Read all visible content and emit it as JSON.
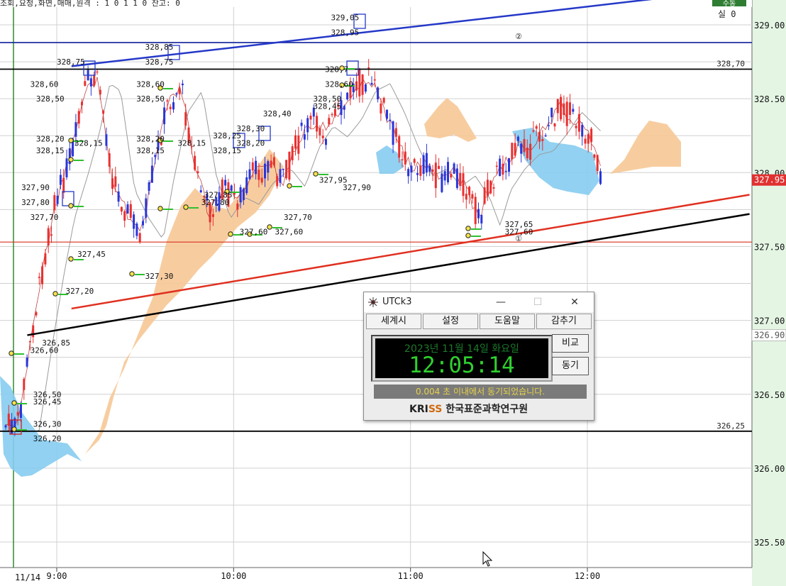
{
  "header": {
    "top_text": "조회,요청,화면,매매,원격 : 1 0 1 1 0 잔고: 0",
    "status_badge": "수동",
    "real_label": "실 0"
  },
  "price_axis": {
    "ticks": [
      "329.00",
      "328.50",
      "328.00",
      "327.50",
      "327.00",
      "326.50",
      "326.00",
      "325.50"
    ],
    "current_price": "327.95",
    "partial_tag": "326.90"
  },
  "time_axis": {
    "date_label": "11/14",
    "ticks": [
      "9:00",
      "10:00",
      "11:00",
      "12:00"
    ]
  },
  "chart_data": {
    "type": "candlestick",
    "y_range": [
      325.3,
      329.15
    ],
    "x_range": [
      "8:45",
      "12:55"
    ],
    "horizontal_lines": [
      {
        "value": 328.7,
        "label": "328,70",
        "color": "#000000"
      },
      {
        "value": 328.88,
        "label": "②",
        "color": "#1e2fa0"
      },
      {
        "value": 327.53,
        "label": "",
        "color": "#d83020"
      },
      {
        "value": 326.25,
        "label": "326,25",
        "color": "#000000"
      }
    ],
    "trend_lines": [
      {
        "label": "",
        "color": "#2438c8",
        "from": [
          "9:05",
          328.72
        ],
        "to": [
          "12:55",
          329.25
        ]
      },
      {
        "label": "①",
        "color": "#e03020",
        "from": [
          "9:05",
          327.08
        ],
        "to": [
          "12:55",
          327.85
        ]
      },
      {
        "label": "",
        "color": "#000000",
        "from": [
          "8:50",
          326.9
        ],
        "to": [
          "12:55",
          327.72
        ]
      }
    ],
    "price_labels": [
      {
        "time": "8:52",
        "price": 326.5,
        "text": "326,50"
      },
      {
        "time": "8:52",
        "price": 326.45,
        "text": "326,45"
      },
      {
        "time": "8:52",
        "price": 326.3,
        "text": "326,30"
      },
      {
        "time": "8:52",
        "price": 326.2,
        "text": "326,20"
      },
      {
        "time": "8:55",
        "price": 326.85,
        "text": "326,85"
      },
      {
        "time": "8:51",
        "price": 326.8,
        "text": "326,60"
      },
      {
        "time": "9:00",
        "price": 328.75,
        "text": "328,75"
      },
      {
        "time": "8:51",
        "price": 328.6,
        "text": "328,60"
      },
      {
        "time": "8:53",
        "price": 328.5,
        "text": "328,50"
      },
      {
        "time": "8:53",
        "price": 328.23,
        "text": "328,20"
      },
      {
        "time": "8:53",
        "price": 328.15,
        "text": "328,15"
      },
      {
        "time": "9:06",
        "price": 328.2,
        "text": "328,15"
      },
      {
        "time": "8:48",
        "price": 327.9,
        "text": "327,90"
      },
      {
        "time": "8:48",
        "price": 327.8,
        "text": "327,80"
      },
      {
        "time": "8:51",
        "price": 327.7,
        "text": "327,70"
      },
      {
        "time": "9:07",
        "price": 327.45,
        "text": "327,45"
      },
      {
        "time": "9:03",
        "price": 327.2,
        "text": "327,20"
      },
      {
        "time": "9:30",
        "price": 328.85,
        "text": "328,85"
      },
      {
        "time": "9:30",
        "price": 328.75,
        "text": "328,75"
      },
      {
        "time": "9:27",
        "price": 328.6,
        "text": "328,60"
      },
      {
        "time": "9:27",
        "price": 328.5,
        "text": "328,50"
      },
      {
        "time": "9:27",
        "price": 328.23,
        "text": "328,20"
      },
      {
        "time": "9:27",
        "price": 328.15,
        "text": "328,15"
      },
      {
        "time": "9:41",
        "price": 328.2,
        "text": "328,15"
      },
      {
        "time": "9:30",
        "price": 327.3,
        "text": "327,30"
      },
      {
        "time": "9:53",
        "price": 328.25,
        "text": "328,25"
      },
      {
        "time": "9:53",
        "price": 328.15,
        "text": "328,15"
      },
      {
        "time": "10:01",
        "price": 328.3,
        "text": "328,30"
      },
      {
        "time": "10:01",
        "price": 328.2,
        "text": "328,20"
      },
      {
        "time": "9:50",
        "price": 327.85,
        "text": "327,85"
      },
      {
        "time": "9:49",
        "price": 327.8,
        "text": "327,80"
      },
      {
        "time": "10:02",
        "price": 327.6,
        "text": "327,60"
      },
      {
        "time": "10:14",
        "price": 327.6,
        "text": "327,60"
      },
      {
        "time": "10:17",
        "price": 327.7,
        "text": "327,70"
      },
      {
        "time": "10:10",
        "price": 328.4,
        "text": "328,40"
      },
      {
        "time": "10:27",
        "price": 328.5,
        "text": "328,50"
      },
      {
        "time": "10:27",
        "price": 328.45,
        "text": "328,45"
      },
      {
        "time": "10:29",
        "price": 327.95,
        "text": "327,95"
      },
      {
        "time": "10:37",
        "price": 327.9,
        "text": "327,90"
      },
      {
        "time": "10:31",
        "price": 328.7,
        "text": "328,7"
      },
      {
        "time": "10:31",
        "price": 328.6,
        "text": "328,60"
      },
      {
        "time": "10:33",
        "price": 329.05,
        "text": "329,05"
      },
      {
        "time": "10:33",
        "price": 328.95,
        "text": "328,95"
      },
      {
        "time": "11:32",
        "price": 327.65,
        "text": "327,65"
      },
      {
        "time": "11:32",
        "price": 327.6,
        "text": "327,60"
      }
    ]
  },
  "utck": {
    "title": "UTCk3",
    "min_glyph": "—",
    "max_glyph": "☐",
    "close_glyph": "✕",
    "menu": [
      "세계시",
      "설정",
      "도움말",
      "감추기"
    ],
    "date": "2023년 11월 14일 화요일",
    "time": "12:05:14",
    "compare_button": "비교",
    "sync_button": "동기",
    "status": "0.004 초 이내에서 동기되었습니다.",
    "logo_prefix": "KRI",
    "logo_s": "SS",
    "logo_org": "한국표준과학연구원",
    "icon": "utck-app-icon"
  }
}
